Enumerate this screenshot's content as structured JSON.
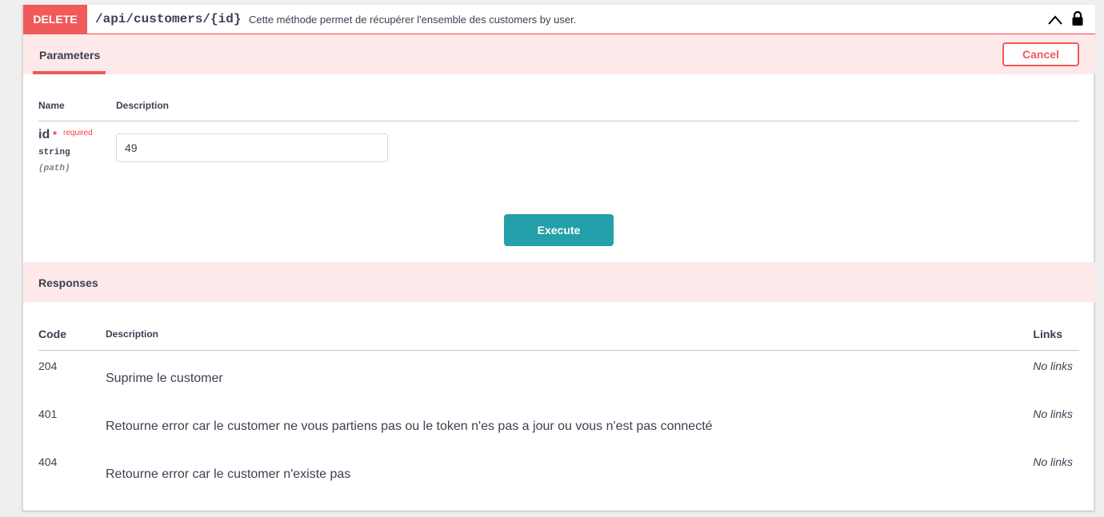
{
  "operation": {
    "method": "DELETE",
    "path": "/api/customers/{id}",
    "summary": "Cette méthode permet de récupérer l'ensemble des customers by user.",
    "method_color": "#f05a5a"
  },
  "parameters": {
    "tab_label": "Parameters",
    "cancel_label": "Cancel",
    "col_name": "Name",
    "col_description": "Description",
    "items": [
      {
        "name": "id",
        "required_mark": "*",
        "required_label": "required",
        "type": "string",
        "in": "(path)",
        "value": "49"
      }
    ],
    "execute_label": "Execute",
    "execute_color": "#23a0a9"
  },
  "responses": {
    "title": "Responses",
    "col_code": "Code",
    "col_description": "Description",
    "col_links": "Links",
    "rows": [
      {
        "code": "204",
        "description": "Suprime le customer",
        "links": "No links"
      },
      {
        "code": "401",
        "description": "Retourne error car le customer ne vous partiens pas ou le token n'es pas a jour ou vous n'est pas connecté",
        "links": "No links"
      },
      {
        "code": "404",
        "description": "Retourne error car le customer n'existe pas",
        "links": "No links"
      }
    ]
  },
  "icons": {
    "collapse": "chevron-up-icon",
    "auth": "lock-icon"
  }
}
